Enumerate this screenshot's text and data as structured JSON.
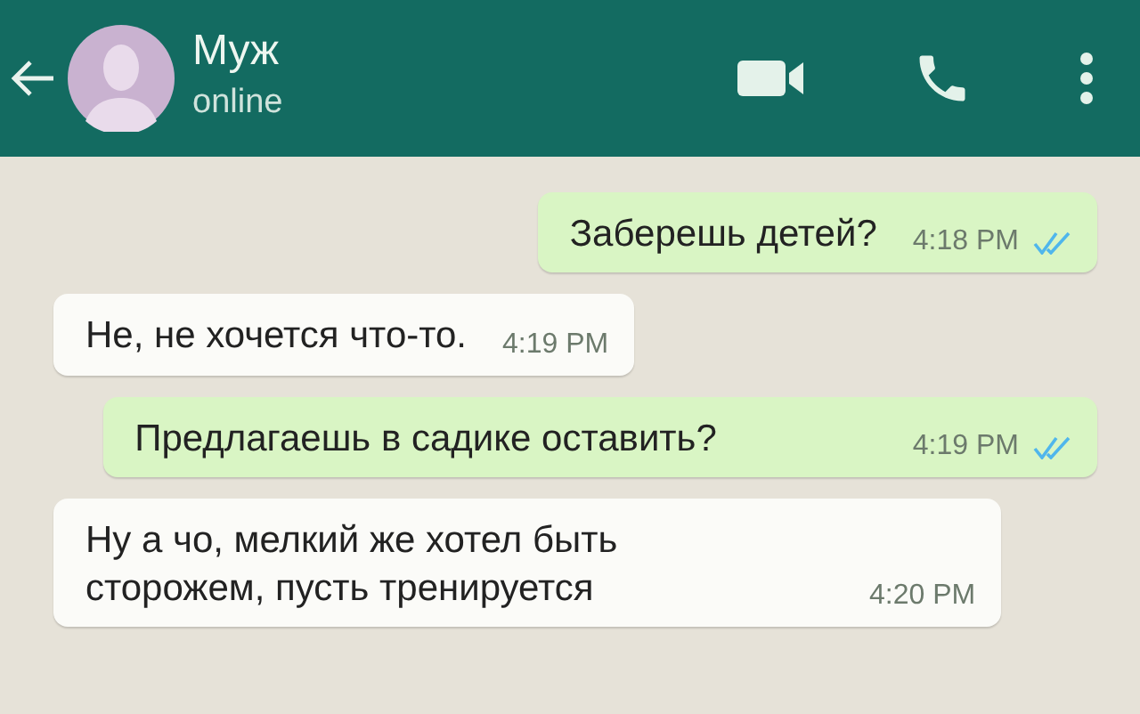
{
  "header": {
    "contact_name": "Муж",
    "status": "online"
  },
  "messages": [
    {
      "kind": "outgoing",
      "text": "Заберешь детей?",
      "time": "4:18 PM",
      "read": true
    },
    {
      "kind": "incoming",
      "text": "Не, не хочется что-то.",
      "time": "4:19 PM"
    },
    {
      "kind": "outgoing",
      "text": "Предлагаешь в садике оставить?",
      "time": "4:19 PM",
      "read": true
    },
    {
      "kind": "incoming",
      "text": "Ну а чо, мелкий же хотел быть сторожем, пусть тренируется",
      "time": "4:20 PM"
    }
  ]
}
